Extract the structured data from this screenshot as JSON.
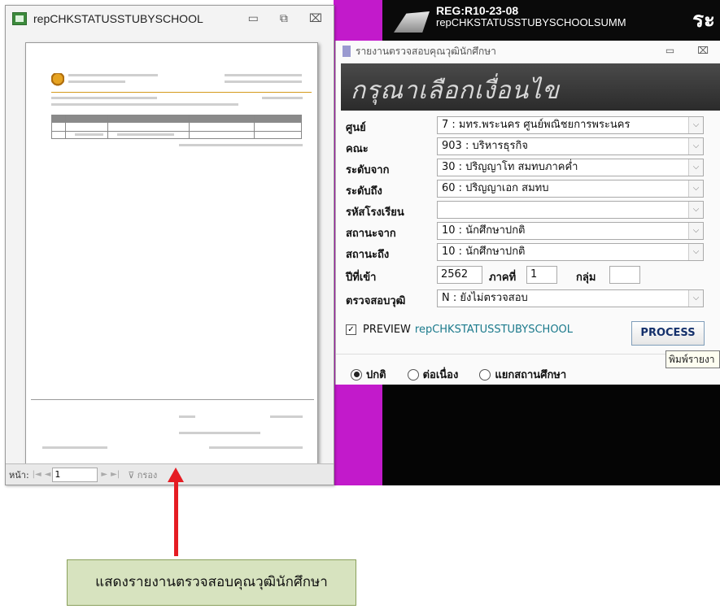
{
  "header_strip": {
    "reg_line": "REG:R10-23-08",
    "report_line": "repCHKSTATUSSTUBYSCHOOLSUMM",
    "thai_fragment": "ระ"
  },
  "preview_window": {
    "title": "repCHKSTATUSSTUBYSCHOOL",
    "minimize": "▭",
    "restore": "⧉",
    "close": "⌧",
    "nav": {
      "page_label": "หน้า:",
      "first": "|◄",
      "prev": "◄",
      "page_value": "1",
      "next": "►",
      "last": "►|",
      "filter_label": "กรอง"
    }
  },
  "dialog": {
    "title": "รายงานตรวจสอบคุณวุฒินักศึกษา",
    "banner": "กรุณาเลือกเงื่อนไข",
    "minimize": "▭",
    "close": "⌧",
    "fields": [
      {
        "label": "ศูนย์",
        "value": "7 : มทร.พระนคร ศูนย์พณิชยการพระนคร"
      },
      {
        "label": "คณะ",
        "value": "903 : บริหารธุรกิจ"
      },
      {
        "label": "ระดับจาก",
        "value": "30 : ปริญญาโท สมทบภาคค่ำ"
      },
      {
        "label": "ระดับถึง",
        "value": "60 : ปริญญาเอก สมทบ"
      },
      {
        "label": "รหัสโรงเรียน",
        "value": ""
      },
      {
        "label": "สถานะจาก",
        "value": "10 : นักศึกษาปกติ"
      },
      {
        "label": "สถานะถึง",
        "value": "10 : นักศึกษาปกติ"
      }
    ],
    "year": {
      "label": "ปีที่เข้า",
      "value": "2562",
      "term_label": "ภาคที่",
      "term_value": "1",
      "group_label": "กลุ่ม",
      "group_value": ""
    },
    "check": {
      "label": "ตรวจสอบวุฒิ",
      "value": "N : ยังไม่ตรวจสอบ"
    },
    "preview": {
      "label": "PREVIEW",
      "value": "repCHKSTATUSSTUBYSCHOOL",
      "checked": true
    },
    "process_button": "PROCESS",
    "radios": [
      {
        "label": "ปกติ",
        "selected": true
      },
      {
        "label": "ต่อเนื่อง",
        "selected": false
      },
      {
        "label": "แยกสถานศึกษา",
        "selected": false
      }
    ],
    "tooltip": "พิมพ์รายงา"
  },
  "caption": "แสดงรายงานตรวจสอบคุณวุฒินักศึกษา",
  "colors": {
    "accent_red": "#e51c23",
    "caption_bg": "#d7e3bf",
    "magenta": "#c21acb"
  }
}
